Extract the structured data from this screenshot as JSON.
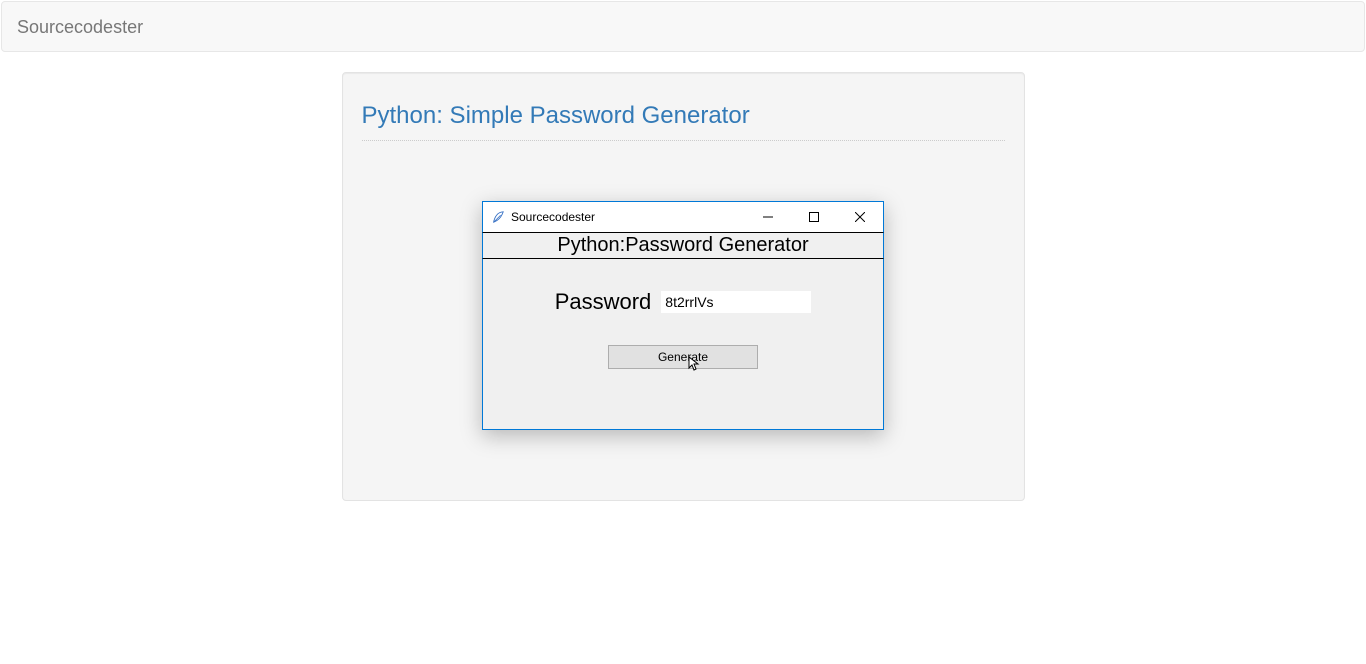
{
  "navbar": {
    "brand": "Sourcecodester"
  },
  "panel": {
    "title": "Python: Simple Password Generator"
  },
  "app_window": {
    "title": "Sourcecodester",
    "header": "Python:Password Generator",
    "password_label": "Password",
    "password_value": "8t2rrlVs",
    "generate_label": "Generate"
  }
}
